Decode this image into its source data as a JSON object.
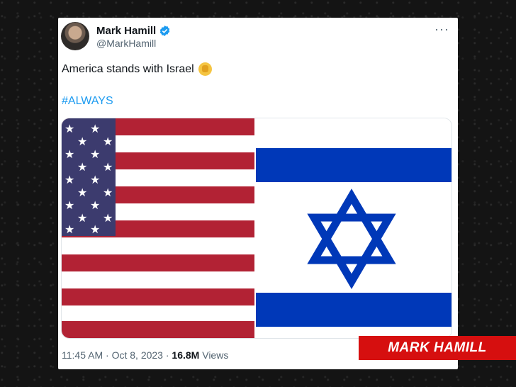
{
  "tweet": {
    "author_name": "Mark Hamill",
    "handle": "@MarkHamill",
    "more_glyph": "···",
    "text": "America stands with Israel",
    "emoji": "raised-fist-emoji",
    "hashtag": "#ALWAYS",
    "time": "11:45 AM",
    "date": "Oct 8, 2023",
    "separator": "·",
    "views_count": "16.8M",
    "views_label": "Views",
    "media_description_icons": [
      "us-flag",
      "israel-flag"
    ]
  },
  "banner": {
    "label": "MARK HAMILL"
  },
  "colors": {
    "link_blue": "#1d9bf0",
    "verified_blue": "#1d9bf0",
    "banner_red": "#d60f0f",
    "flag_red": "#b22234",
    "flag_blue": "#3c3b6e",
    "israel_blue": "#0038b8"
  }
}
